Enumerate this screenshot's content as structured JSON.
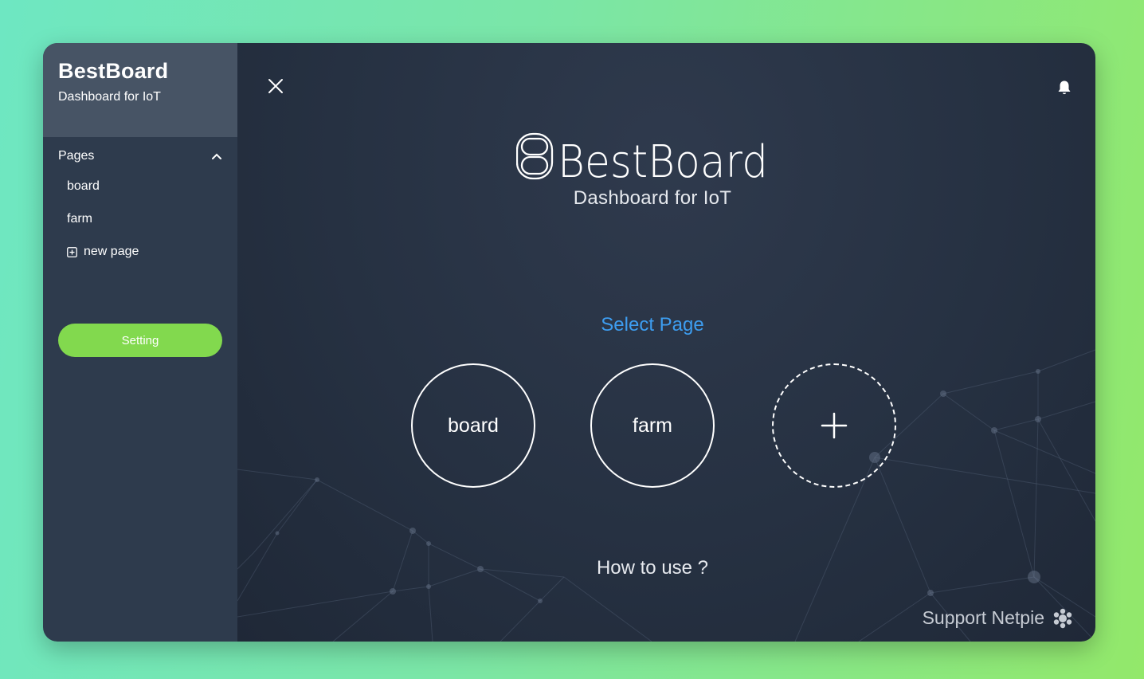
{
  "brand": {
    "title": "BestBoard",
    "subtitle": "Dashboard for IoT"
  },
  "sidebar": {
    "section_label": "Pages",
    "items": [
      {
        "label": "board"
      },
      {
        "label": "farm"
      },
      {
        "label": "new page",
        "icon": "plus-square-icon"
      }
    ],
    "setting_label": "Setting"
  },
  "main": {
    "logo_text": "BestBoard",
    "subtitle": "Dashboard for IoT",
    "select_title": "Select Page",
    "pages": [
      {
        "label": "board"
      },
      {
        "label": "farm"
      }
    ],
    "add_icon": "plus-icon",
    "howto_label": "How to use ?",
    "support_label": "Support Netpie"
  },
  "colors": {
    "sidebar_bg": "#2e3b4d",
    "brand_bg": "#475465",
    "main_bg": "#263142",
    "accent_green": "#82d94e",
    "accent_blue": "#3d9df0"
  }
}
